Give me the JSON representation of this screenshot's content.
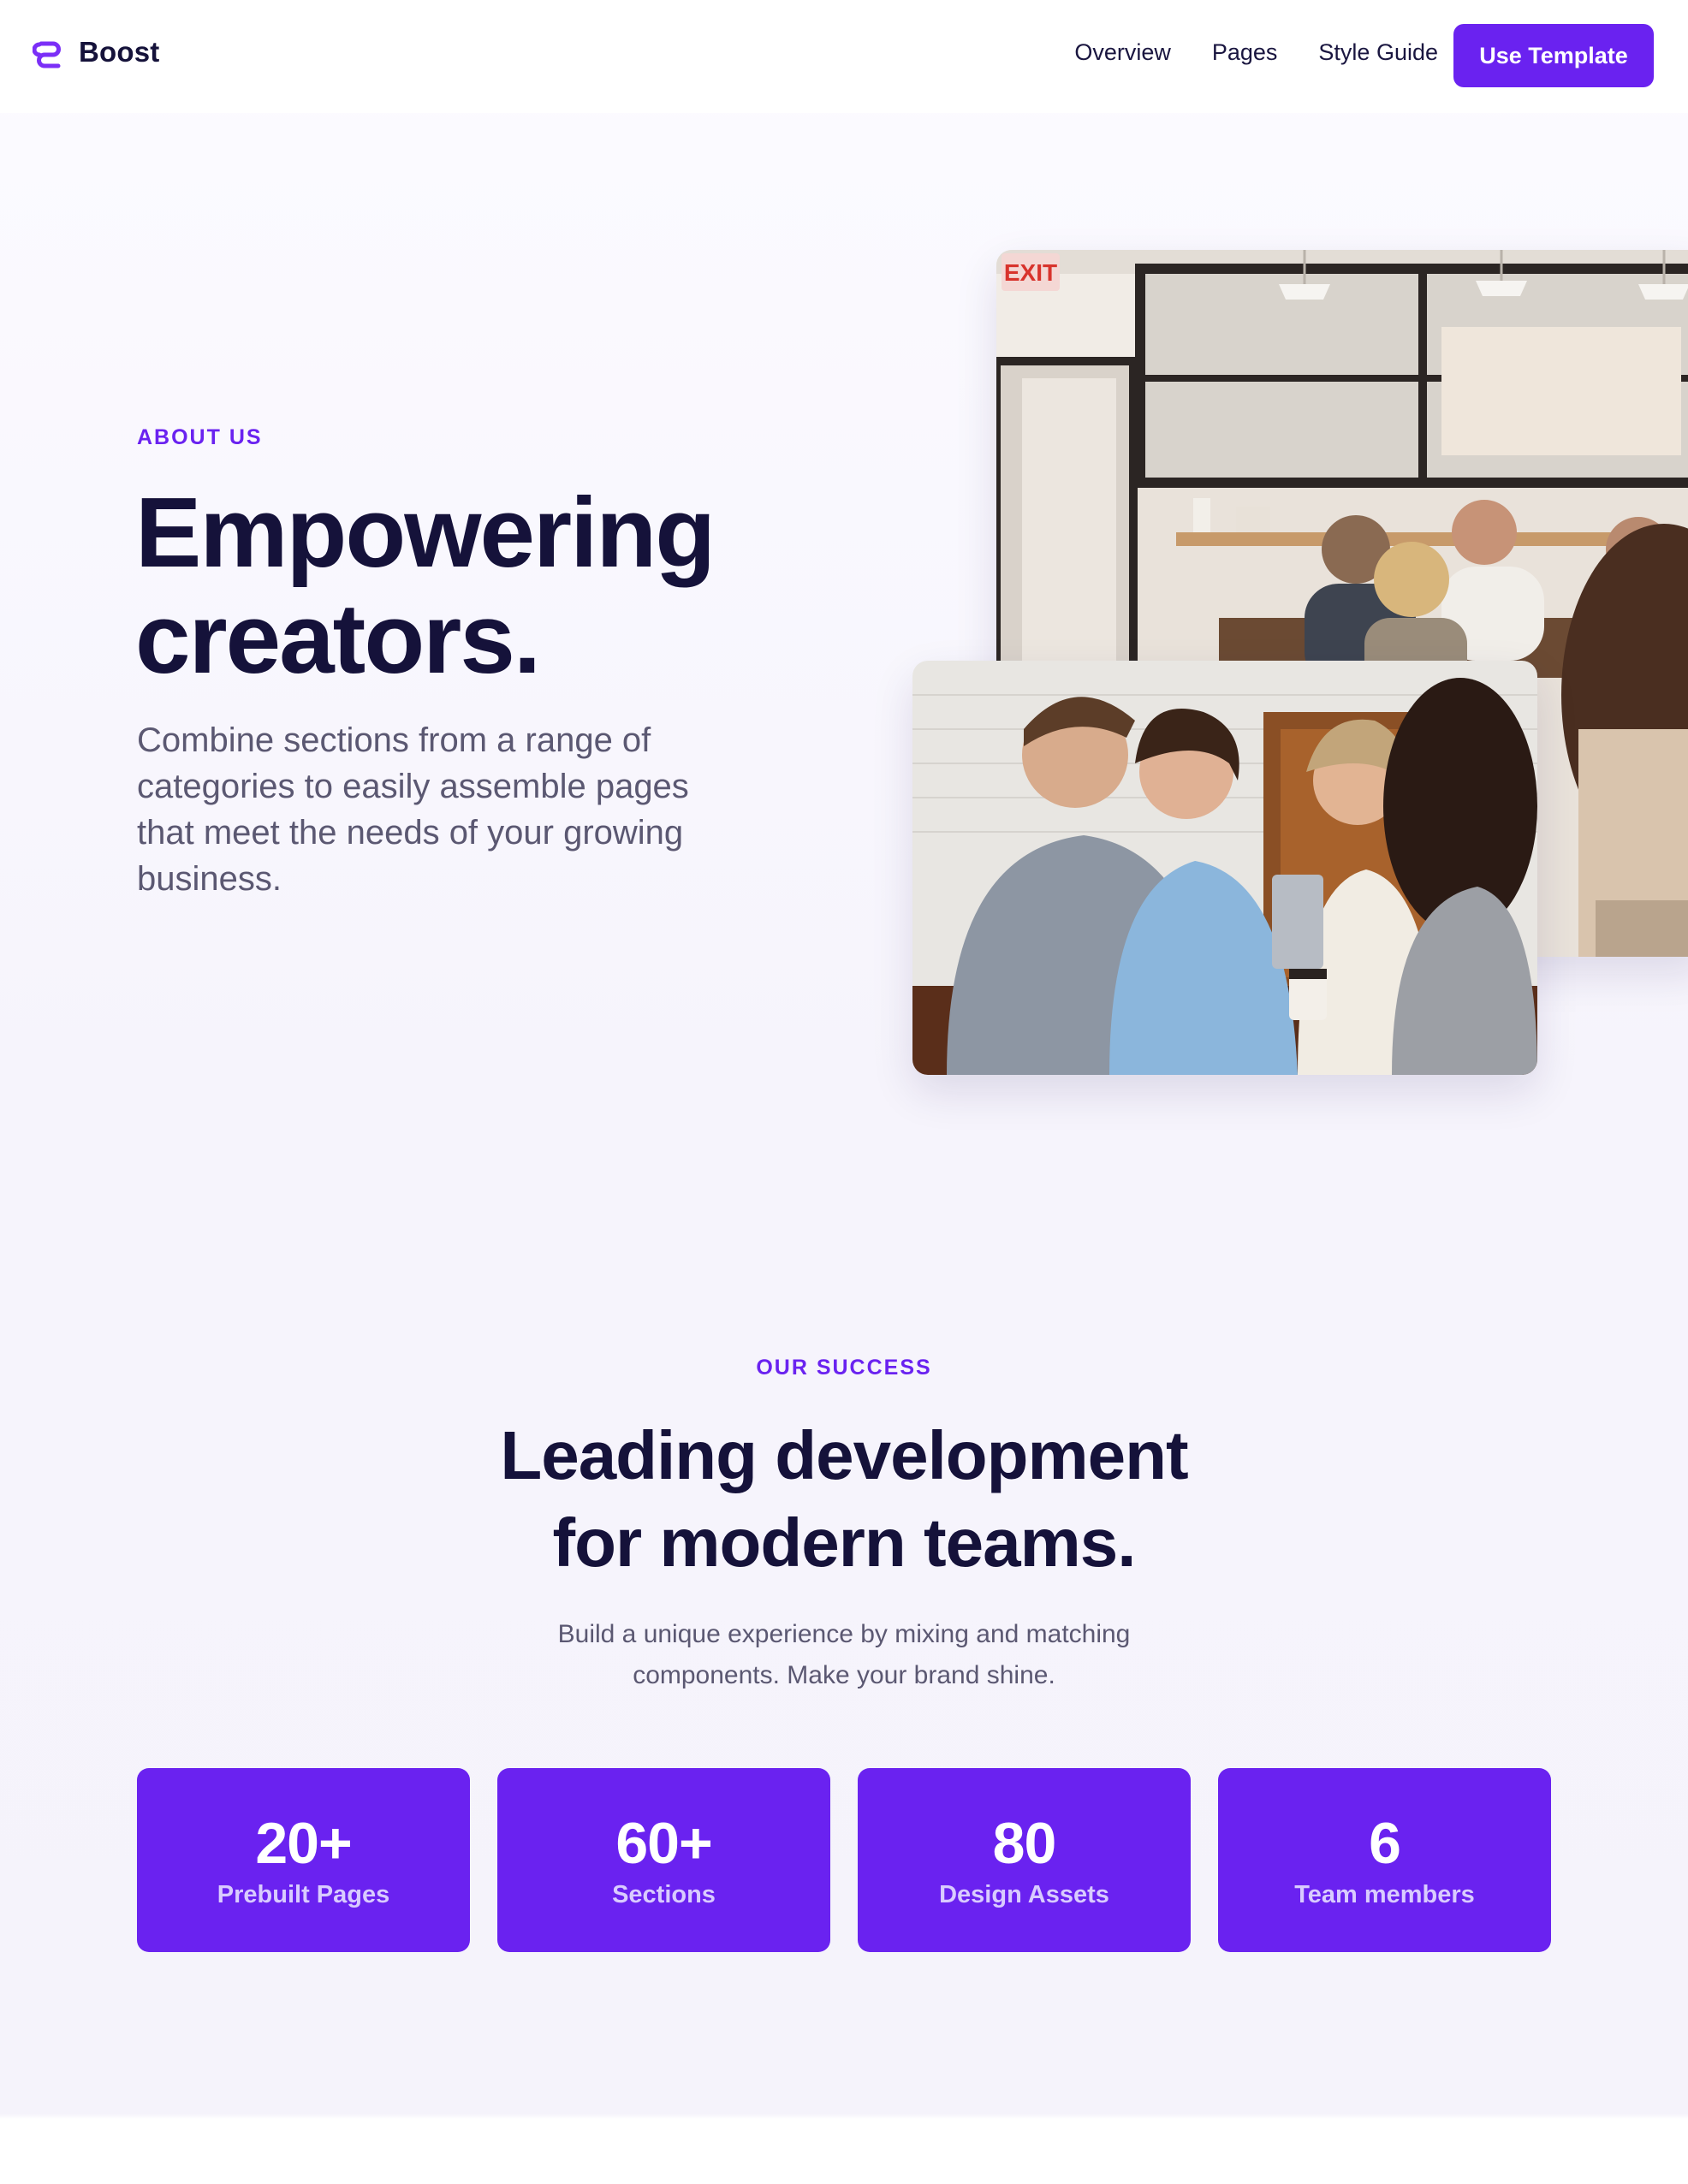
{
  "header": {
    "brand_name": "Boost",
    "brand_icon": "link-loop-icon",
    "nav": [
      {
        "label": "Overview"
      },
      {
        "label": "Pages"
      },
      {
        "label": "Style Guide"
      }
    ],
    "cta_label": "Use Template"
  },
  "hero": {
    "eyebrow": "ABOUT US",
    "title_line1": "Empowering",
    "title_line2": "creators.",
    "description": "Combine sections from a range of categories to easily assemble pages that meet the needs of your growing business.",
    "photo_back_sign": "EXIT"
  },
  "success": {
    "eyebrow": "OUR SUCCESS",
    "title_line1": "Leading development",
    "title_line2": "for modern teams.",
    "description": "Build a unique experience by mixing and matching components. Make your brand shine.",
    "stats": [
      {
        "value": "20+",
        "label": "Prebuilt Pages"
      },
      {
        "value": "60+",
        "label": "Sections"
      },
      {
        "value": "80",
        "label": "Design Assets"
      },
      {
        "value": "6",
        "label": "Team members"
      }
    ]
  },
  "colors": {
    "accent": "#6a22f0",
    "heading": "#15123a",
    "body": "#5b5872",
    "stat_label": "#d9cbff"
  }
}
